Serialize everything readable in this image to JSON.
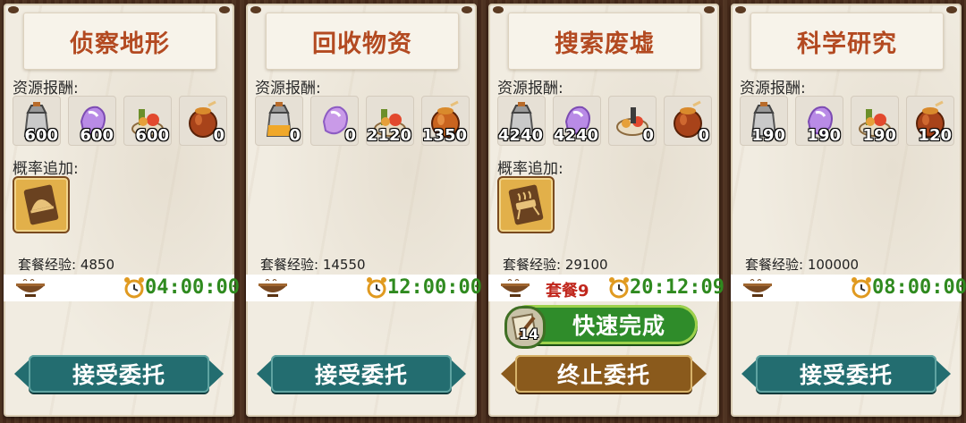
{
  "labels": {
    "resource_reward": "资源报酬:",
    "probability_bonus": "概率追加:",
    "exp_prefix": "套餐经验: "
  },
  "icons": [
    "kettle-icon",
    "crystal-icon",
    "food-basket-icon",
    "honey-jar-icon"
  ],
  "cards": [
    {
      "title": "侦察地形",
      "resources": [
        "600",
        "600",
        "600",
        "0"
      ],
      "has_bonus": true,
      "bonus_icon": "cloche-card-icon",
      "exp": "4850",
      "timer": "04:00:00",
      "meal": "",
      "action": "接受委托"
    },
    {
      "title": "回收物资",
      "resources": [
        "0",
        "0",
        "2120",
        "1350"
      ],
      "has_bonus": false,
      "exp": "14550",
      "timer": "12:00:00",
      "meal": "",
      "action": "接受委托"
    },
    {
      "title": "搜索废墟",
      "resources": [
        "4240",
        "4240",
        "0",
        "0"
      ],
      "has_bonus": true,
      "bonus_icon": "grill-card-icon",
      "exp": "29100",
      "timer": "20:12:09",
      "meal": "套餐9",
      "quick_label": "快速完成",
      "quick_count": "14",
      "action": "终止委托"
    },
    {
      "title": "科学研究",
      "resources": [
        "190",
        "190",
        "190",
        "120"
      ],
      "has_bonus": false,
      "exp": "100000",
      "timer": "08:00:00",
      "meal": "",
      "action": "接受委托"
    }
  ],
  "colors": {
    "title": "#b34a21",
    "timer": "#2f8a1f",
    "meal": "#c0261c",
    "accept_button": "#236d70",
    "stop_button": "#8a5a1c",
    "quick_button": "#2f8c2a"
  }
}
